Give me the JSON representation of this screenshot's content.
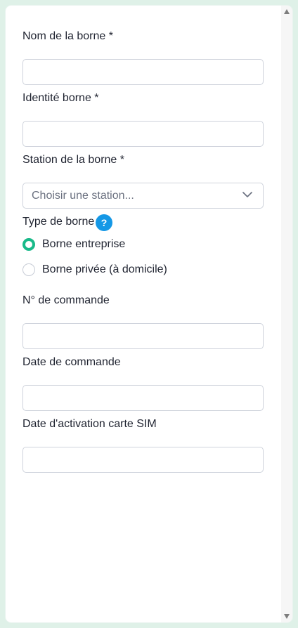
{
  "form": {
    "station_name": {
      "label": "Nom de la borne *",
      "value": ""
    },
    "station_identity": {
      "label": "Identité borne *",
      "value": ""
    },
    "station_site": {
      "label": "Station de la borne *",
      "selected": "Choisir une station..."
    },
    "station_type": {
      "label": "Type de borne",
      "help": "?",
      "options": [
        {
          "label": "Borne entreprise",
          "checked": true
        },
        {
          "label": "Borne privée (à domicile)",
          "checked": false
        }
      ]
    },
    "order_number": {
      "label": "N° de commande",
      "value": ""
    },
    "order_date": {
      "label": "Date de commande",
      "value": ""
    },
    "sim_activation_date": {
      "label": "Date d'activation carte SIM",
      "value": ""
    }
  },
  "theme": {
    "accent_green": "#19b989",
    "help_blue": "#1598e6",
    "page_tint": "#dff1e8"
  }
}
